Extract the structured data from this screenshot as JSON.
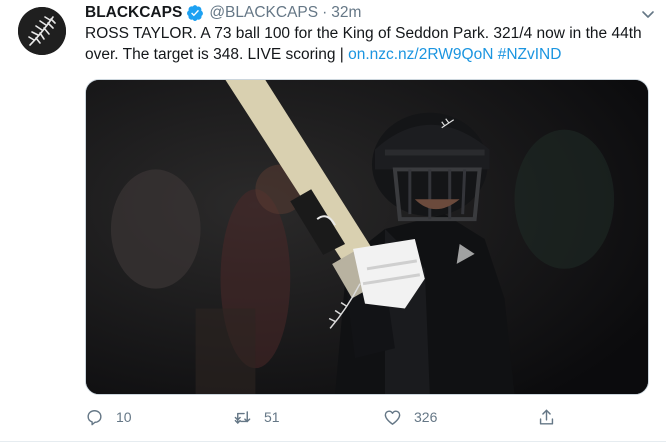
{
  "tweet": {
    "display_name": "BLACKCAPS",
    "handle": "@BLACKCAPS",
    "separator": "·",
    "time": "32m",
    "text": "ROSS TAYLOR. A 73 ball 100 for the King of Seddon Park. 321/4 now in the 44th over. The target is 348. LIVE scoring | ",
    "link": "on.nzc.nz/2RW9QoN",
    "hashtag": "#NZvIND"
  },
  "actions": {
    "reply_count": "10",
    "retweet_count": "51",
    "like_count": "326"
  },
  "icons": {
    "avatar": "silver-fern-icon",
    "verified": "verified-badge-icon",
    "more": "chevron-down-icon",
    "reply": "reply-icon",
    "retweet": "retweet-icon",
    "like": "heart-icon",
    "share": "share-icon"
  },
  "colors": {
    "link": "#1b95e0",
    "muted": "#657786",
    "verified": "#1da1f2"
  }
}
